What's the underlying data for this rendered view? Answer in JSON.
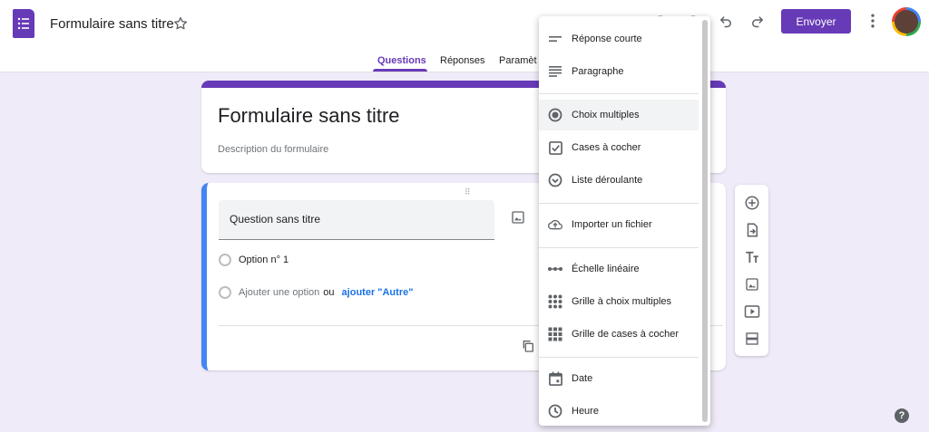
{
  "header": {
    "doc_title": "Formulaire sans titre",
    "send_label": "Envoyer"
  },
  "tabs": [
    {
      "label": "Questions"
    },
    {
      "label": "Réponses"
    },
    {
      "label": "Paramèt"
    }
  ],
  "title_card": {
    "title": "Formulaire sans titre",
    "description": "Description du formulaire"
  },
  "question": {
    "title": "Question sans titre",
    "option1": "Option n° 1",
    "add_option": "Ajouter une option",
    "or": "ou",
    "add_other": "ajouter \"Autre\""
  },
  "menu": {
    "items": [
      {
        "label": "Réponse courte",
        "icon": "short-answer-icon"
      },
      {
        "label": "Paragraphe",
        "icon": "paragraph-icon"
      },
      {
        "label": "Choix multiples",
        "icon": "radio-icon"
      },
      {
        "label": "Cases à cocher",
        "icon": "checkbox-icon"
      },
      {
        "label": "Liste déroulante",
        "icon": "dropdown-icon"
      },
      {
        "label": "Importer un fichier",
        "icon": "cloud-upload-icon"
      },
      {
        "label": "Échelle linéaire",
        "icon": "linear-scale-icon"
      },
      {
        "label": "Grille à choix multiples",
        "icon": "grid-icon"
      },
      {
        "label": "Grille de cases à cocher",
        "icon": "checkbox-grid-icon"
      },
      {
        "label": "Date",
        "icon": "calendar-icon"
      },
      {
        "label": "Heure",
        "icon": "clock-icon"
      }
    ],
    "selected": "Choix multiples"
  },
  "help": "?"
}
